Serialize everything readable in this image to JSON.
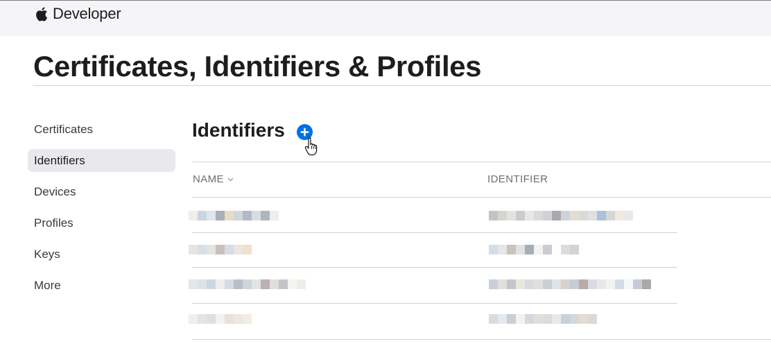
{
  "header": {
    "brand": "Developer",
    "logo_icon": "apple-logo-icon"
  },
  "page": {
    "title": "Certificates, Identifiers & Profiles"
  },
  "sidebar": {
    "items": [
      {
        "label": "Certificates"
      },
      {
        "label": "Identifiers",
        "active": true
      },
      {
        "label": "Devices"
      },
      {
        "label": "Profiles"
      },
      {
        "label": "Keys"
      },
      {
        "label": "More"
      }
    ]
  },
  "section": {
    "title": "Identifiers",
    "add_icon": "plus-circle-icon",
    "accent": "#0071e3"
  },
  "table": {
    "columns": [
      {
        "label": "NAME",
        "sort_icon": "chevron-down-icon"
      },
      {
        "label": "IDENTIFIER"
      }
    ],
    "rows_note_icon": "redacted-pixelated",
    "row_count": 4
  }
}
